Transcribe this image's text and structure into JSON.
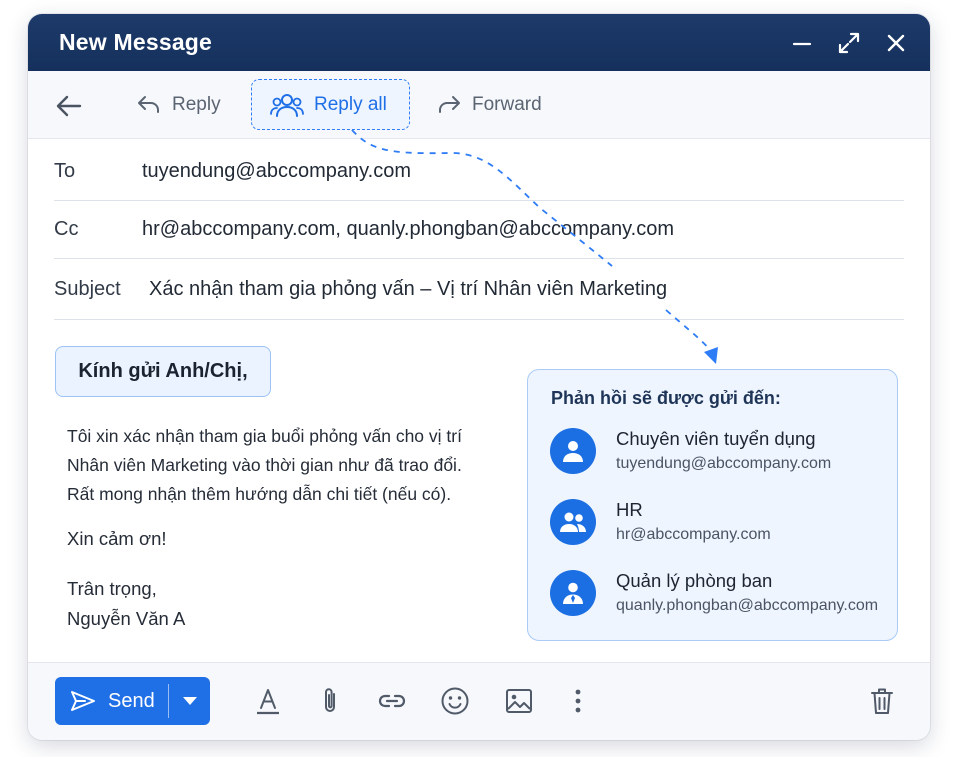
{
  "window": {
    "title": "New Message"
  },
  "toolbar": {
    "reply_label": "Reply",
    "reply_all_label": "Reply all",
    "forward_label": "Forward"
  },
  "fields": {
    "to_label": "To",
    "to_value": "tuyendung@abccompany.com",
    "cc_label": "Cc",
    "cc_value": "hr@abccompany.com, quanly.phongban@abccompany.com",
    "subject_label": "Subject",
    "subject_value": "Xác nhận tham gia phỏng vấn – Vị trí Nhân viên Marketing"
  },
  "body": {
    "greeting": "Kính gửi Anh/Chị,",
    "lines": [
      "Tôi xin xác nhận tham gia buổi phỏng vấn cho vị trí",
      "Nhân viên Marketing vào thời gian như đã trao đổi.",
      "Rất mong nhận thêm hướng dẫn chi tiết (nếu có)."
    ],
    "thanks": "Xin cảm ơn!",
    "closing": "Trân trọng,",
    "signature": "Nguyễn Văn A"
  },
  "panel": {
    "title": "Phản hồi sẽ được gửi đến:",
    "recipients": [
      {
        "name": "Chuyên viên tuyển dụng",
        "email": "tuyendung@abccompany.com",
        "icon": "person-icon"
      },
      {
        "name": "HR",
        "email": "hr@abccompany.com",
        "icon": "group-icon"
      },
      {
        "name": "Quản lý phòng ban",
        "email": "quanly.phongban@abccompany.com",
        "icon": "manager-icon"
      }
    ]
  },
  "bottombar": {
    "send_label": "Send",
    "icons": [
      "text-format-icon",
      "attach-icon",
      "link-icon",
      "emoji-icon",
      "image-icon",
      "more-icon",
      "trash-icon"
    ]
  },
  "colors": {
    "titlebar": "#15305c",
    "accent": "#1f6fe6",
    "panel_bg": "#eef5ff"
  }
}
